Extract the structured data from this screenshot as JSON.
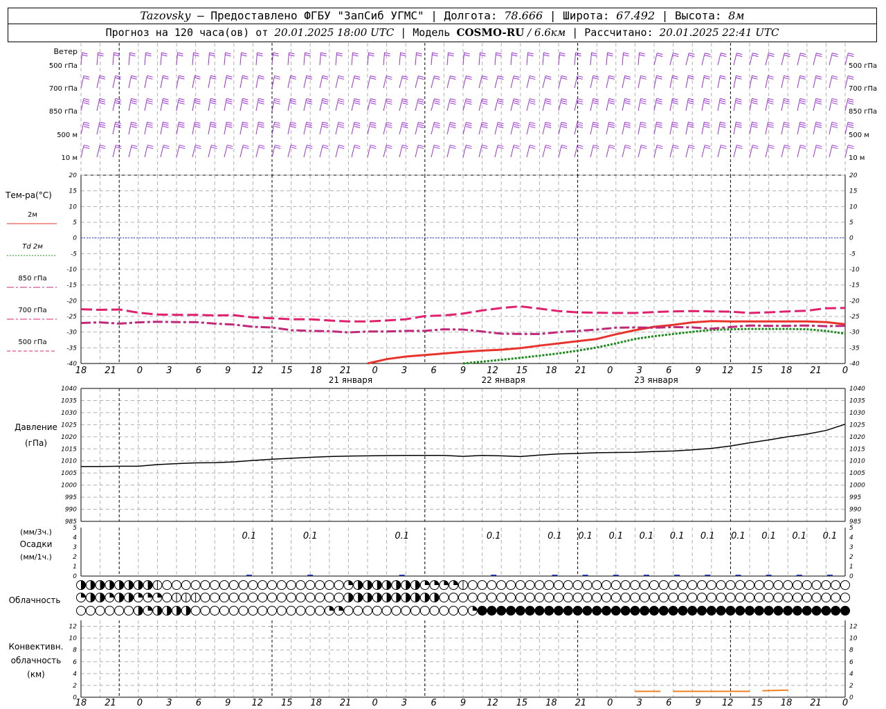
{
  "header": {
    "station": "Tazovsky",
    "dash": " – ",
    "provided": "Предоставлено ФГБУ \"ЗапСиб УГМС\"",
    "sep": " | ",
    "lon_label": "Долгота: ",
    "lon": "78.666",
    "lat_label": "Широта: ",
    "lat": "67.492",
    "alt_label": "Высота: ",
    "alt": "8м",
    "forecast_label": "Прогноз на 120 часа(ов) от ",
    "forecast_time": "20.01.2025 18:00 UTC",
    "model_label": "Модель ",
    "model": "COSMO-RU",
    "resolution": " / 6.6км",
    "calc_label": "Рассчитано: ",
    "calc_time": "20.01.2025 22:41 UTC"
  },
  "time_axis": {
    "ticks": [
      "18",
      "21",
      "0",
      "3",
      "6",
      "9",
      "12",
      "15",
      "18",
      "21",
      "0",
      "3",
      "6",
      "9",
      "12",
      "15",
      "18",
      "21",
      "0",
      "3",
      "6",
      "9",
      "12",
      "15",
      "18",
      "21",
      "0"
    ],
    "day_labels": [
      "21 января",
      "22 января",
      "23 января"
    ]
  },
  "wind_panel": {
    "title": "Ветер",
    "levels": [
      "500 гПа",
      "700 гПа",
      "850 гПа",
      "500 м",
      "10  м"
    ]
  },
  "colors": {
    "t2m": "#e8322c",
    "td2m": "#1a8a1a",
    "t850": "#c0287a",
    "t700": "#e0206e",
    "t500": "#e0206e",
    "zero": "#2040e0",
    "wind": "#9a30d0",
    "precip": "#2030a0",
    "convective": "#f08020",
    "grid": "#aaaaaa"
  },
  "chart_data": [
    {
      "type": "line",
      "title": "Тем-ра(°C)",
      "x_unit": "hours since 20.01.2025 18:00 UTC",
      "ylim": [
        -40,
        20
      ],
      "yticks": [
        20,
        15,
        10,
        5,
        0,
        -5,
        -10,
        -15,
        -20,
        -25,
        -30,
        -35,
        -40
      ],
      "grid": true,
      "series": [
        {
          "name": "2м",
          "key": "t2m",
          "style": "solid",
          "x": [
            45,
            48,
            51,
            54,
            57,
            60,
            63,
            66,
            69,
            72,
            75,
            78,
            81,
            84,
            87,
            90,
            93,
            96,
            99,
            102,
            105,
            108,
            111,
            114,
            117,
            120
          ],
          "y": [
            -40,
            -38.6,
            -37.8,
            -37.3,
            -36.8,
            -36.3,
            -35.9,
            -35.6,
            -35.1,
            -34.3,
            -33.6,
            -32.9,
            -32.2,
            -30.7,
            -29.4,
            -28.3,
            -27.7,
            -26.9,
            -26.5,
            -26.6,
            -26.6,
            -26.6,
            -26.6,
            -26.6,
            -26.8,
            -27.5
          ]
        },
        {
          "name": "Td 2м",
          "key": "td2m",
          "style": "dotted",
          "x": [
            60,
            63,
            66,
            69,
            72,
            75,
            78,
            81,
            84,
            87,
            90,
            93,
            96,
            99,
            102,
            105,
            108,
            111,
            114,
            117,
            120
          ],
          "y": [
            -40,
            -39.4,
            -38.8,
            -38.2,
            -37.5,
            -36.8,
            -35.9,
            -34.9,
            -33.6,
            -32.2,
            -31.3,
            -30.6,
            -29.9,
            -29.3,
            -29.1,
            -29.0,
            -29.0,
            -29.0,
            -29.1,
            -29.6,
            -30.5
          ]
        },
        {
          "name": "850 гПа",
          "key": "t850",
          "style": "dashdot",
          "x": [
            0,
            3,
            6,
            9,
            12,
            15,
            18,
            21,
            24,
            27,
            30,
            33,
            36,
            39,
            42,
            45,
            48,
            51,
            54,
            57,
            60,
            63,
            66,
            69,
            72,
            75,
            78,
            81,
            84,
            87,
            90,
            93,
            96,
            99,
            102,
            105,
            108,
            111,
            114,
            117,
            120
          ],
          "y": [
            -27.1,
            -26.9,
            -27.3,
            -26.9,
            -26.7,
            -26.8,
            -26.8,
            -27.3,
            -27.6,
            -28.3,
            -28.5,
            -29.4,
            -29.6,
            -29.7,
            -30.1,
            -29.8,
            -29.8,
            -29.6,
            -29.6,
            -29.1,
            -29.2,
            -29.8,
            -30.5,
            -30.6,
            -30.6,
            -30.0,
            -29.6,
            -29.2,
            -28.6,
            -28.5,
            -28.6,
            -28.4,
            -28.5,
            -28.9,
            -28.4,
            -27.9,
            -28.0,
            -28.0,
            -27.9,
            -28.1,
            -28.0
          ]
        }
      ]
    },
    {
      "type": "line",
      "title": "Давление",
      "ylabel": "(гПа)",
      "x_unit": "hours since 20.01.2025 18:00 UTC",
      "ylim": [
        985,
        1040
      ],
      "yticks": [
        1040,
        1035,
        1030,
        1025,
        1020,
        1015,
        1010,
        1005,
        1000,
        995,
        990,
        985
      ],
      "grid": true,
      "series": [
        {
          "name": "Давление",
          "key": "pressure",
          "x": [
            0,
            3,
            6,
            9,
            12,
            15,
            18,
            21,
            24,
            27,
            30,
            33,
            36,
            39,
            42,
            45,
            48,
            51,
            54,
            57,
            60,
            63,
            66,
            69,
            72,
            75,
            78,
            81,
            84,
            87,
            90,
            93,
            96,
            99,
            102,
            105,
            108,
            111,
            114,
            117,
            120
          ],
          "y": [
            1007.7,
            1007.7,
            1007.8,
            1007.8,
            1008.5,
            1008.9,
            1009.2,
            1009.3,
            1009.6,
            1010.2,
            1010.7,
            1011.1,
            1011.5,
            1011.8,
            1012.0,
            1012.1,
            1012.2,
            1012.3,
            1012.3,
            1012.3,
            1011.9,
            1012.3,
            1012.1,
            1011.8,
            1012.4,
            1012.9,
            1013.1,
            1013.4,
            1013.5,
            1013.6,
            1013.9,
            1014.1,
            1014.6,
            1015.2,
            1016.2,
            1017.5,
            1018.7,
            1020.0,
            1021.1,
            1022.6,
            1025.2
          ]
        }
      ]
    },
    {
      "type": "bar",
      "title": "Осадки",
      "ylabel_top": "(мм/3ч.)",
      "ylabel_bottom": "(мм/1ч.)",
      "x_unit": "hours since 20.01.2025 18:00 UTC",
      "ylim": [
        0,
        5
      ],
      "yticks": [
        5,
        4,
        3,
        2,
        1,
        0
      ],
      "labels": [
        {
          "x": 33,
          "text": "0.1"
        },
        {
          "x": 45,
          "text": "0.1"
        },
        {
          "x": 63,
          "text": "0.1"
        },
        {
          "x": 81,
          "text": "0.1"
        },
        {
          "x": 93,
          "text": "0.1"
        },
        {
          "x": 99,
          "text": "0.1"
        },
        {
          "x": 105,
          "text": "0.1"
        },
        {
          "x": 111,
          "text": "0.1"
        },
        {
          "x": 117,
          "text": "0.1"
        },
        {
          "x": 123,
          "text": "0.1"
        },
        {
          "x": 129,
          "text": "0.1"
        },
        {
          "x": 135,
          "text": "0.1"
        },
        {
          "x": 141,
          "text": "0.1"
        },
        {
          "x": 147,
          "text": "0.1"
        }
      ]
    },
    {
      "type": "table",
      "title": "Облачность",
      "rows": [
        "hhhhhhhhfeeeeeeeeeeeeeeeeeeeqhhhhhhhqqqqfeeeeeeeeeeeeeeeeeeeeeeeeeeeeeeeeeeeeeeee",
        "qhhqhhqqqefffeeeeeeeeeeeeeeehhhhhhhhhheeeeeeeeeeeeeeeeeeeeeeeeeeeeeeeeeeeeeeeeeee",
        "eeeeeehqhhhheeeeeeeeeeeeeeqqeeeeeeeeeeeeeqFFFFFFFFFFFFFFFFFFFFFFFFFFFFFFFFFFFFFFF"
      ]
    },
    {
      "type": "line",
      "title": "Конвективн.",
      "ylabel": "облачность",
      "yunit": "(км)",
      "x_unit": "hours since 20.01.2025 18:00 UTC",
      "ylim": [
        0,
        13
      ],
      "yticks": [
        12,
        10,
        8,
        6,
        4,
        2,
        0
      ],
      "grid": true,
      "series": [
        {
          "name": "Конвективная облачность",
          "key": "convective",
          "segments": [
            {
              "x": [
                87,
                91
              ],
              "y": [
                1,
                1
              ]
            },
            {
              "x": [
                93,
                105
              ],
              "y": [
                1,
                1
              ]
            },
            {
              "x": [
                107,
                111
              ],
              "y": [
                1.1,
                1.2
              ]
            }
          ]
        }
      ]
    }
  ],
  "temp_legend": [
    {
      "label": "2м",
      "key": "t2m",
      "style": "solid"
    },
    {
      "label": "Td  2м",
      "key": "td2m",
      "style": "dotted"
    },
    {
      "label": "850 гПа",
      "key": "t850",
      "style": "dashdot"
    },
    {
      "label": "700 гПа",
      "key": "t700",
      "style": "dashdot"
    },
    {
      "label": "500 гПа",
      "key": "t500",
      "style": "dashed"
    }
  ],
  "temp_extra": {
    "t500": {
      "x": [
        0,
        3,
        6,
        9,
        12,
        15,
        18,
        21,
        24,
        27,
        30,
        33,
        36,
        39,
        42,
        45,
        48,
        51,
        54,
        57,
        60,
        63,
        66,
        69,
        72,
        75,
        78,
        81,
        84,
        87,
        90,
        93,
        96,
        99,
        102,
        105,
        108,
        111,
        114,
        117,
        120
      ],
      "y": [
        -22.7,
        -22.9,
        -22.8,
        -23.8,
        -24.4,
        -24.5,
        -24.5,
        -24.7,
        -24.6,
        -25.3,
        -25.6,
        -25.9,
        -25.9,
        -26.3,
        -26.6,
        -26.6,
        -26.3,
        -25.9,
        -24.9,
        -24.7,
        -24.1,
        -23.1,
        -22.3,
        -21.8,
        -22.5,
        -23.3,
        -23.7,
        -23.8,
        -23.9,
        -23.9,
        -23.6,
        -23.4,
        -23.3,
        -23.4,
        -23.5,
        -23.9,
        -23.7,
        -23.4,
        -23.2,
        -22.4,
        -22.3
      ]
    }
  }
}
